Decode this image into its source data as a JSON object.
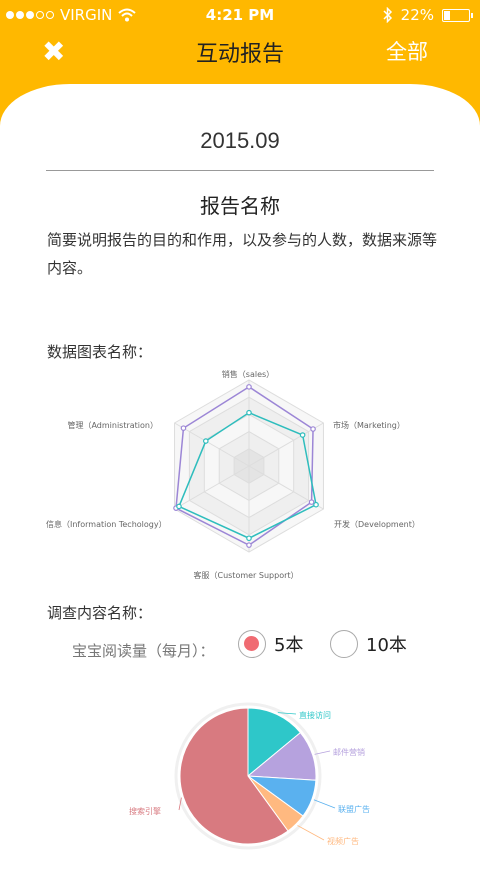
{
  "status_bar": {
    "carrier": "VIRGIN",
    "time": "4:21 PM",
    "battery": "22%"
  },
  "header": {
    "title": "互动报告",
    "right_action": "全部"
  },
  "report": {
    "date": "2015.09",
    "title": "报告名称",
    "description": "简要说明报告的目的和作用，以及参与的人数，数据来源等内容。"
  },
  "chart_section_title": "数据图表名称：",
  "survey": {
    "title": "调查内容名称：",
    "question": "宝宝阅读量（每月）：",
    "options": [
      {
        "label": "5本",
        "selected": true
      },
      {
        "label": "10本",
        "selected": false
      }
    ]
  },
  "chart_data": [
    {
      "type": "radar",
      "indicators": [
        "销售（sales）",
        "市场（Marketing）",
        "开发（Development）",
        "客服（Customer Support）",
        "信息（Information Techology）",
        "管理（Administration）"
      ],
      "max": 100,
      "series": [
        {
          "color": "#9c86d6",
          "values": [
            92,
            86,
            84,
            92,
            98,
            88
          ]
        },
        {
          "color": "#2ebdbd",
          "values": [
            62,
            72,
            90,
            84,
            94,
            58
          ]
        }
      ]
    },
    {
      "type": "pie",
      "slices": [
        {
          "label": "直接访问",
          "value": 14,
          "color": "#2ec7c9"
        },
        {
          "label": "邮件营销",
          "value": 12,
          "color": "#b6a2de"
        },
        {
          "label": "联盟广告",
          "value": 9,
          "color": "#5ab1ef"
        },
        {
          "label": "视频广告",
          "value": 5,
          "color": "#ffb980"
        },
        {
          "label": "搜索引擎",
          "value": 60,
          "color": "#d87a80"
        }
      ]
    }
  ]
}
